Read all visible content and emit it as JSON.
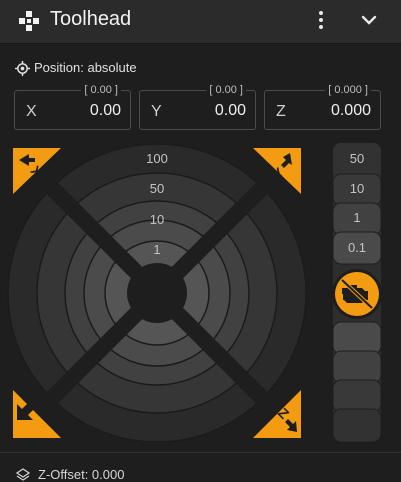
{
  "header": {
    "title": "Toolhead",
    "icons": {
      "title": "toolhead-dpad-icon",
      "menu": "more-vert-icon",
      "collapse": "chevron-down-icon"
    }
  },
  "position": {
    "label": "Position: absolute",
    "icon": "crosshair-icon"
  },
  "fields": [
    {
      "axis": "X",
      "value": "0.00",
      "tag": "[ 0.00 ]"
    },
    {
      "axis": "Y",
      "value": "0.00",
      "tag": "[ 0.00 ]"
    },
    {
      "axis": "Z",
      "value": "0.000",
      "tag": "[ 0.000 ]"
    }
  ],
  "xy_steps": [
    "100",
    "50",
    "10",
    "1"
  ],
  "z_steps": [
    "50",
    "10",
    "1",
    "0.1"
  ],
  "corner_buttons": {
    "home_x": "X",
    "home_y": "Y",
    "home_z": "Z",
    "home_all": "home-all-icon"
  },
  "motors_off_icon": "engine-off-icon",
  "zoffset": {
    "label": "Z-Offset: 0.000",
    "icon": "layers-icon"
  },
  "colors": {
    "accent": "#f39c12",
    "panel": "#1e1e1e",
    "header": "#2b2b2b"
  }
}
